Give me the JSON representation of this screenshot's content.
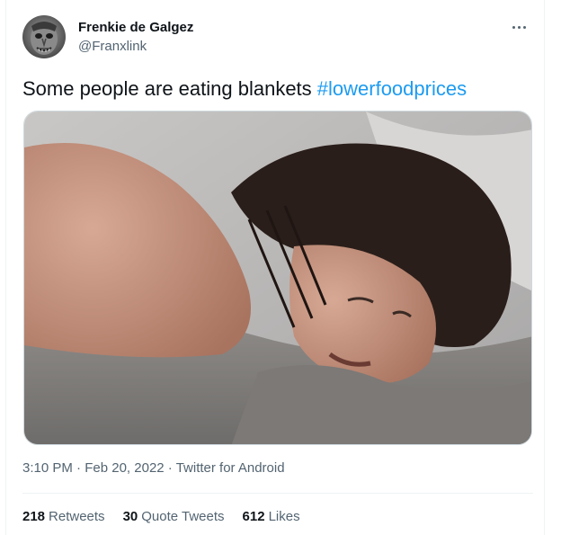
{
  "author": {
    "name": "Frenkie de Galgez",
    "handle": "@Franxlink",
    "avatar_icon": "grotesque-face-avatar"
  },
  "more_icon": "more-horizontal-icon",
  "tweet": {
    "text": "Some people are eating blankets ",
    "hashtag": "#lowerfoodprices"
  },
  "meta": {
    "time": "3:10 PM",
    "sep1": " · ",
    "date": "Feb 20, 2022",
    "sep2": " · ",
    "source": "Twitter for Android"
  },
  "stats": {
    "retweets_count": "218",
    "retweets_label": "Retweets",
    "quotes_count": "30",
    "quotes_label": "Quote Tweets",
    "likes_count": "612",
    "likes_label": "Likes"
  },
  "colors": {
    "link": "#1d9bf0",
    "secondary_text": "#536471",
    "primary_text": "#0f1419",
    "divider": "#eff3f4"
  }
}
